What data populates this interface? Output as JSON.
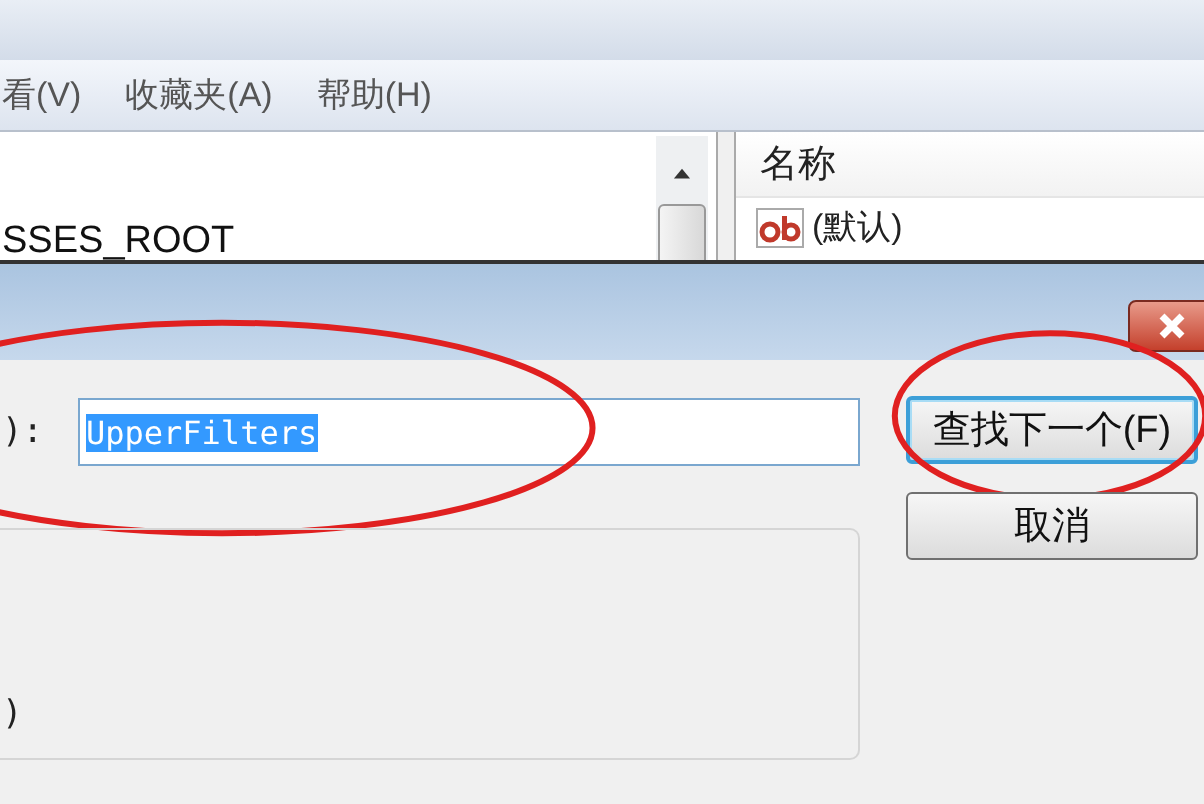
{
  "background_window": {
    "menu": [
      {
        "label": "看(V)"
      },
      {
        "label": "收藏夹(A)"
      },
      {
        "label": "帮助(H)"
      }
    ],
    "tree": {
      "items": [
        {
          "label": "SSES_ROOT"
        }
      ]
    },
    "values": {
      "columns": [
        {
          "label": "名称"
        }
      ],
      "rows": [
        {
          "name": "(默认)"
        }
      ]
    }
  },
  "dialog": {
    "field_label": "):",
    "search": {
      "value": "UpperFilters",
      "circled": true
    },
    "buttons": [
      {
        "label": "查找下一个(F)",
        "kind": "default",
        "circled": true
      },
      {
        "label": "取消",
        "kind": "normal",
        "circled": false
      }
    ],
    "group_label": ")"
  }
}
